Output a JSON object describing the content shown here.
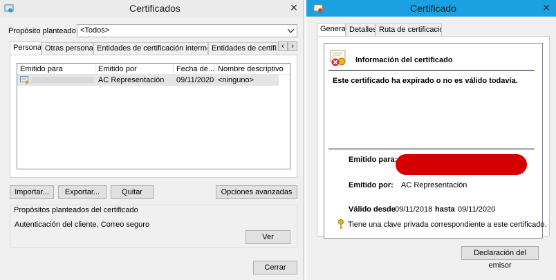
{
  "left": {
    "title": "Certificados",
    "close_glyph": "✕",
    "purpose_label": "Propósito planteado:",
    "purpose_value": "<Todos>",
    "tabs": [
      {
        "label": "Personal"
      },
      {
        "label": "Otras personas"
      },
      {
        "label": "Entidades de certificación intermedias"
      },
      {
        "label": "Entidades de certificaci"
      }
    ],
    "tab_scroll_left": "‹",
    "tab_scroll_right": "›",
    "columns": [
      "Emitido para",
      "Emitido por",
      "Fecha de...",
      "Nombre descriptivo"
    ],
    "rows": [
      {
        "issued_to": "",
        "issued_by": "AC Representación",
        "date": "09/11/2020",
        "friendly": "<ninguno>"
      }
    ],
    "buttons": {
      "import": "Importar...",
      "export": "Exportar...",
      "remove": "Quitar",
      "advanced": "Opciones avanzadas",
      "view": "Ver",
      "close": "Cerrar"
    },
    "purposes_group_label": "Propósitos planteados del certificado",
    "purposes_text": "Autenticación del cliente, Correo seguro"
  },
  "right": {
    "title": "Certificado",
    "close_glyph": "✕",
    "tabs": [
      {
        "label": "General"
      },
      {
        "label": "Detalles"
      },
      {
        "label": "Ruta de certificación"
      }
    ],
    "info_title": "Información del certificado",
    "status": "Este certificado ha expirado o no es válido todavía.",
    "issued_to_label": "Emitido para:",
    "issued_to_value": "",
    "issued_by_label": "Emitido por:",
    "issued_by_value": "AC Representación",
    "valid_from_label": "Válido desde",
    "valid_from_value": "09/11/2018",
    "valid_to_label": "hasta",
    "valid_to_value": "09/11/2020",
    "private_key_text": "Tiene una clave privada correspondiente a este certificado.",
    "issuer_statement_button": "Declaración del emisor",
    "redaction_color": "#d40000",
    "accent_color": "#1ba1e2"
  }
}
